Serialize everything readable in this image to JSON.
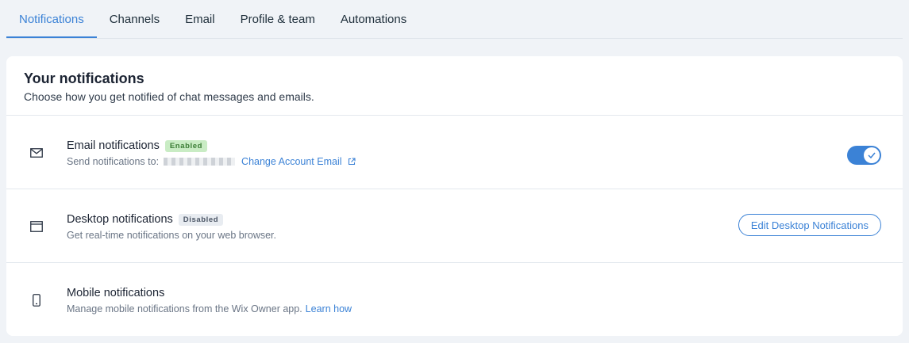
{
  "tabs": [
    {
      "label": "Notifications",
      "active": true
    },
    {
      "label": "Channels"
    },
    {
      "label": "Email"
    },
    {
      "label": "Profile & team"
    },
    {
      "label": "Automations"
    }
  ],
  "card": {
    "title": "Your notifications",
    "subtitle": "Choose how you get notified of chat messages and emails."
  },
  "email": {
    "title": "Email notifications",
    "badge": "Enabled",
    "desc_prefix": "Send notifications to:",
    "change_link": "Change Account Email",
    "toggle_on": true
  },
  "desktop": {
    "title": "Desktop notifications",
    "badge": "Disabled",
    "desc": "Get real-time notifications on your web browser.",
    "button": "Edit Desktop Notifications"
  },
  "mobile": {
    "title": "Mobile notifications",
    "desc": "Manage mobile notifications from the Wix Owner app.",
    "link": "Learn how"
  },
  "colors": {
    "accent": "#3b82d6",
    "enabled_bg": "#c9ecc4",
    "disabled_bg": "#e8ecf1"
  }
}
